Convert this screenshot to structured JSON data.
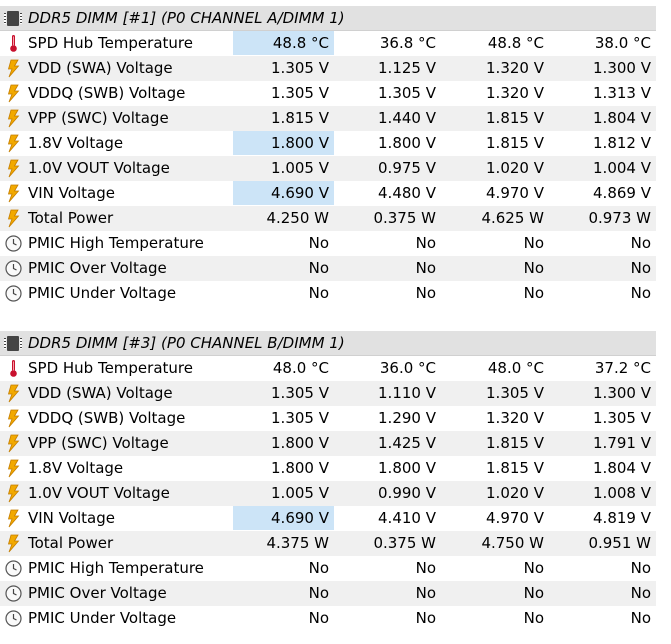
{
  "groups": [
    {
      "title": "DDR5 DIMM [#1] (P0 CHANNEL A/DIMM 1)",
      "rows": [
        {
          "icon": "thermometer-icon",
          "label": "SPD Hub Temperature",
          "values": [
            "48.8 °C",
            "36.8 °C",
            "48.8 °C",
            "38.0 °C"
          ],
          "highlight": [
            0
          ]
        },
        {
          "icon": "lightning-icon",
          "label": "VDD (SWA) Voltage",
          "values": [
            "1.305 V",
            "1.125 V",
            "1.320 V",
            "1.300 V"
          ],
          "highlight": []
        },
        {
          "icon": "lightning-icon",
          "label": "VDDQ (SWB) Voltage",
          "values": [
            "1.305 V",
            "1.305 V",
            "1.320 V",
            "1.313 V"
          ],
          "highlight": []
        },
        {
          "icon": "lightning-icon",
          "label": "VPP (SWC) Voltage",
          "values": [
            "1.815 V",
            "1.440 V",
            "1.815 V",
            "1.804 V"
          ],
          "highlight": []
        },
        {
          "icon": "lightning-icon",
          "label": "1.8V Voltage",
          "values": [
            "1.800 V",
            "1.800 V",
            "1.815 V",
            "1.812 V"
          ],
          "highlight": [
            0
          ]
        },
        {
          "icon": "lightning-icon",
          "label": "1.0V VOUT Voltage",
          "values": [
            "1.005 V",
            "0.975 V",
            "1.020 V",
            "1.004 V"
          ],
          "highlight": []
        },
        {
          "icon": "lightning-icon",
          "label": "VIN Voltage",
          "values": [
            "4.690 V",
            "4.480 V",
            "4.970 V",
            "4.869 V"
          ],
          "highlight": [
            0
          ]
        },
        {
          "icon": "lightning-icon",
          "label": "Total Power",
          "values": [
            "4.250 W",
            "0.375 W",
            "4.625 W",
            "0.973 W"
          ],
          "highlight": []
        },
        {
          "icon": "clock-icon",
          "label": "PMIC High Temperature",
          "values": [
            "No",
            "No",
            "No",
            "No"
          ],
          "highlight": []
        },
        {
          "icon": "clock-icon",
          "label": "PMIC Over Voltage",
          "values": [
            "No",
            "No",
            "No",
            "No"
          ],
          "highlight": []
        },
        {
          "icon": "clock-icon",
          "label": "PMIC Under Voltage",
          "values": [
            "No",
            "No",
            "No",
            "No"
          ],
          "highlight": []
        }
      ]
    },
    {
      "title": "DDR5 DIMM [#3] (P0 CHANNEL B/DIMM 1)",
      "rows": [
        {
          "icon": "thermometer-icon",
          "label": "SPD Hub Temperature",
          "values": [
            "48.0 °C",
            "36.0 °C",
            "48.0 °C",
            "37.2 °C"
          ],
          "highlight": []
        },
        {
          "icon": "lightning-icon",
          "label": "VDD (SWA) Voltage",
          "values": [
            "1.305 V",
            "1.110 V",
            "1.305 V",
            "1.300 V"
          ],
          "highlight": []
        },
        {
          "icon": "lightning-icon",
          "label": "VDDQ (SWB) Voltage",
          "values": [
            "1.305 V",
            "1.290 V",
            "1.320 V",
            "1.305 V"
          ],
          "highlight": []
        },
        {
          "icon": "lightning-icon",
          "label": "VPP (SWC) Voltage",
          "values": [
            "1.800 V",
            "1.425 V",
            "1.815 V",
            "1.791 V"
          ],
          "highlight": []
        },
        {
          "icon": "lightning-icon",
          "label": "1.8V Voltage",
          "values": [
            "1.800 V",
            "1.800 V",
            "1.815 V",
            "1.804 V"
          ],
          "highlight": []
        },
        {
          "icon": "lightning-icon",
          "label": "1.0V VOUT Voltage",
          "values": [
            "1.005 V",
            "0.990 V",
            "1.020 V",
            "1.008 V"
          ],
          "highlight": []
        },
        {
          "icon": "lightning-icon",
          "label": "VIN Voltage",
          "values": [
            "4.690 V",
            "4.410 V",
            "4.970 V",
            "4.819 V"
          ],
          "highlight": [
            0
          ]
        },
        {
          "icon": "lightning-icon",
          "label": "Total Power",
          "values": [
            "4.375 W",
            "0.375 W",
            "4.750 W",
            "0.951 W"
          ],
          "highlight": []
        },
        {
          "icon": "clock-icon",
          "label": "PMIC High Temperature",
          "values": [
            "No",
            "No",
            "No",
            "No"
          ],
          "highlight": []
        },
        {
          "icon": "clock-icon",
          "label": "PMIC Over Voltage",
          "values": [
            "No",
            "No",
            "No",
            "No"
          ],
          "highlight": []
        },
        {
          "icon": "clock-icon",
          "label": "PMIC Under Voltage",
          "values": [
            "No",
            "No",
            "No",
            "No"
          ],
          "highlight": []
        }
      ]
    }
  ],
  "colors": {
    "header_bg": "#e1e1e1",
    "row_alt_bg": "#f0f0f0",
    "highlight_bg": "#cce4f7",
    "thermometer": "#c8102e",
    "lightning": "#f2a900"
  }
}
